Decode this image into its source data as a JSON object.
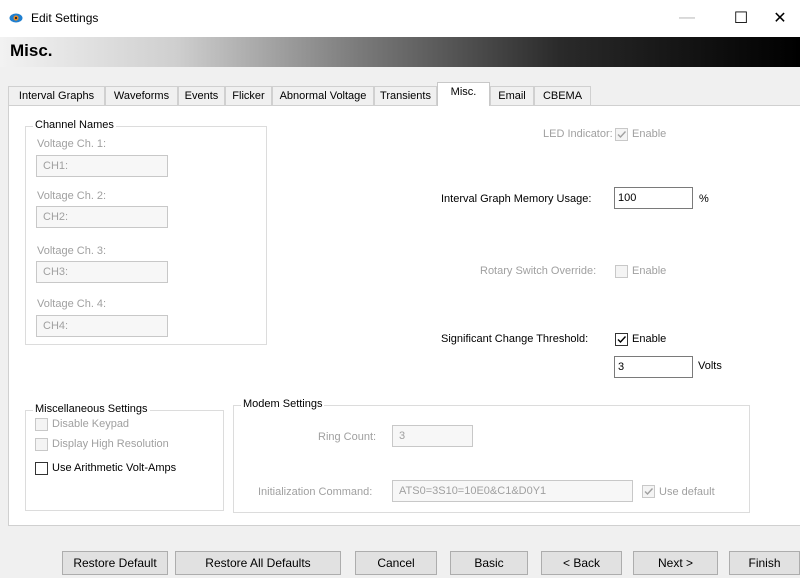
{
  "window": {
    "title": "Edit Settings",
    "minimize_glyph": "—",
    "maximize_glyph": "☐",
    "close_glyph": "✕"
  },
  "header": {
    "title": "Misc."
  },
  "tabs": [
    {
      "label": "Interval Graphs"
    },
    {
      "label": "Waveforms"
    },
    {
      "label": "Events"
    },
    {
      "label": "Flicker"
    },
    {
      "label": "Abnormal Voltage"
    },
    {
      "label": "Transients"
    },
    {
      "label": "Misc.",
      "active": true
    },
    {
      "label": "Email"
    },
    {
      "label": "CBEMA"
    }
  ],
  "channel_names": {
    "legend": "Channel Names",
    "channels": [
      {
        "label": "Voltage Ch. 1:",
        "value": "CH1:"
      },
      {
        "label": "Voltage Ch. 2:",
        "value": "CH2:"
      },
      {
        "label": "Voltage Ch. 3:",
        "value": "CH3:"
      },
      {
        "label": "Voltage Ch. 4:",
        "value": "CH4:"
      }
    ]
  },
  "led_indicator": {
    "label": "LED Indicator:",
    "checkbox_label": "Enable",
    "checked": true,
    "enabled": false
  },
  "memory_usage": {
    "label": "Interval Graph Memory Usage:",
    "value": "100",
    "unit": "%"
  },
  "rotary_override": {
    "label": "Rotary Switch Override:",
    "checkbox_label": "Enable",
    "checked": false,
    "enabled": false
  },
  "change_threshold": {
    "label": "Significant Change Threshold:",
    "checkbox_label": "Enable",
    "checked": true,
    "value": "3",
    "unit": "Volts"
  },
  "misc_settings": {
    "legend": "Miscellaneous Settings",
    "disable_keypad": "Disable Keypad",
    "display_high_res": "Display High Resolution",
    "arithmetic_va": "Use Arithmetic Volt-Amps"
  },
  "modem_settings": {
    "legend": "Modem Settings",
    "ring_count_label": "Ring Count:",
    "ring_count_value": "3",
    "init_label": "Initialization Command:",
    "init_value": "ATS0=3S10=10E0&C1&D0Y1",
    "use_default_label": "Use default"
  },
  "buttons": {
    "restore_default": "Restore Default",
    "restore_all": "Restore All Defaults",
    "cancel": "Cancel",
    "basic": "Basic",
    "back": "< Back",
    "next": "Next >",
    "finish": "Finish"
  },
  "colors": {
    "disabled_text": "#a0a0a0",
    "panel_bg": "#f0f0f0",
    "check_enabled": "#000000",
    "check_disabled": "#a0a0a0"
  }
}
